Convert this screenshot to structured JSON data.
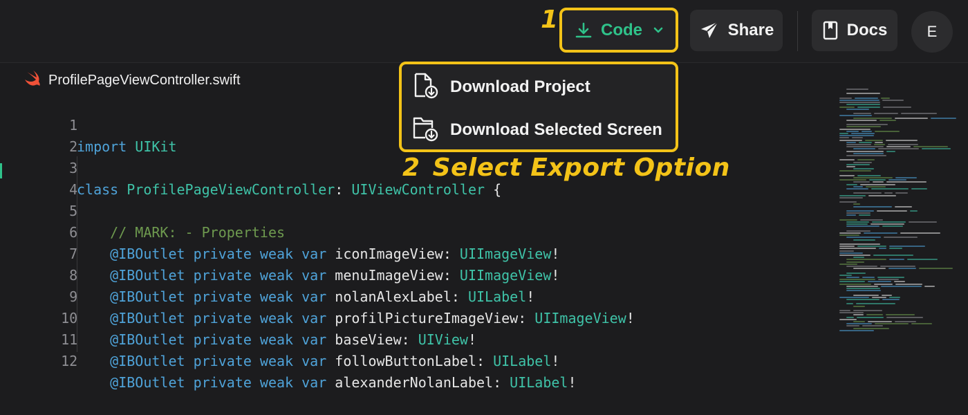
{
  "toolbar": {
    "step1_label": "1",
    "code_label": "Code",
    "share_label": "Share",
    "docs_label": "Docs",
    "avatar_initial": "E"
  },
  "dropdown": {
    "items": [
      {
        "label": "Download Project",
        "icon": "file-download-icon"
      },
      {
        "label": "Download Selected Screen",
        "icon": "folder-download-icon"
      }
    ]
  },
  "annotation": {
    "step2_number": "2",
    "step2_label": "Select Export Option"
  },
  "editor": {
    "file_name": "ProfilePageViewController.swift",
    "file_icon": "swift-icon",
    "line_numbers": [
      "1",
      "2",
      "3",
      "4",
      "5",
      "6",
      "7",
      "8",
      "9",
      "10",
      "11",
      "12"
    ]
  },
  "colors": {
    "highlight": "#f3c318",
    "accent": "#2fc28a",
    "keyword": "#4fa3d9",
    "type": "#3fc3a8",
    "comment": "#6e9a4f"
  }
}
